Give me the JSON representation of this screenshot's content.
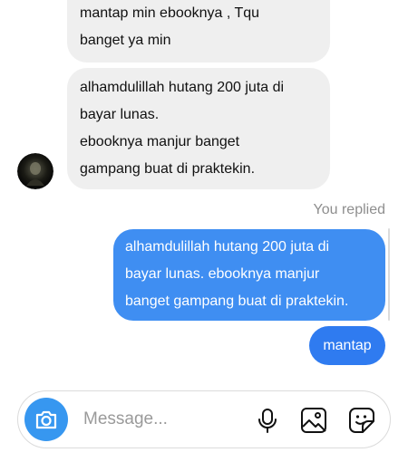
{
  "conversation": {
    "incoming": [
      {
        "lines": [
          "mantap min ebooknya , Tqu",
          "banget ya min"
        ]
      },
      {
        "lines": [
          "alhamdulillah hutang 200 juta di",
          "bayar lunas.",
          "ebooknya manjur banget",
          "gampang buat di praktekin."
        ]
      }
    ],
    "replied_label": "You replied",
    "outgoing_reply": {
      "lines": [
        "alhamdulillah hutang 200 juta di",
        "bayar lunas. ebooknya manjur",
        "banget gampang buat di praktekin."
      ]
    },
    "outgoing_message": "mantap"
  },
  "composer": {
    "placeholder": "Message...",
    "icons": [
      "camera-icon",
      "microphone-icon",
      "image-icon",
      "sticker-icon"
    ]
  },
  "colors": {
    "incoming_bubble": "#efefef",
    "outgoing_bubble": "#3f8ef2",
    "camera_button": "#3797f0",
    "muted_text": "#8e8e8e"
  }
}
